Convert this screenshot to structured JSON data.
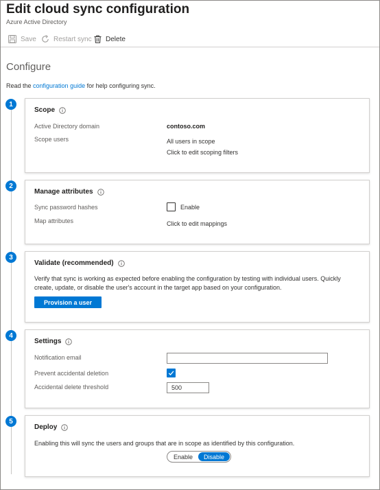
{
  "header": {
    "title": "Edit cloud sync configuration",
    "subtitle": "Azure Active Directory"
  },
  "toolbar": {
    "save_label": "Save",
    "restart_label": "Restart sync",
    "delete_label": "Delete"
  },
  "main": {
    "section_title": "Configure",
    "intro_prefix": "Read the ",
    "intro_link": "configuration guide",
    "intro_suffix": " for help configuring sync."
  },
  "steps": {
    "scope": {
      "number": "1",
      "title": "Scope",
      "domain_label": "Active Directory domain",
      "domain_value": "contoso.com",
      "users_label": "Scope users",
      "users_value": "All users in scope",
      "users_link": "Click to edit scoping filters"
    },
    "attributes": {
      "number": "2",
      "title": "Manage attributes",
      "password_label": "Sync password hashes",
      "password_checkbox_label": "Enable",
      "password_checked": false,
      "map_label": "Map attributes",
      "map_link": "Click to edit mappings"
    },
    "validate": {
      "number": "3",
      "title": "Validate (recommended)",
      "description": "Verify that sync is working as expected before enabling the configuration by testing with individual users. Quickly create, update, or disable the user's account in the target app based on your configuration.",
      "button_label": "Provision a user"
    },
    "settings": {
      "number": "4",
      "title": "Settings",
      "email_label": "Notification email",
      "email_value": "",
      "prevent_label": "Prevent accidental deletion",
      "prevent_checked": true,
      "threshold_label": "Accidental delete threshold",
      "threshold_value": "500"
    },
    "deploy": {
      "number": "5",
      "title": "Deploy",
      "description": "Enabling this will sync the users and groups that are in scope as identified by this configuration.",
      "enable_label": "Enable",
      "disable_label": "Disable",
      "selected": "Disable"
    }
  },
  "colors": {
    "accent": "#0078d4",
    "text": "#323130",
    "muted": "#605e5c",
    "disabled": "#a19f9d"
  }
}
